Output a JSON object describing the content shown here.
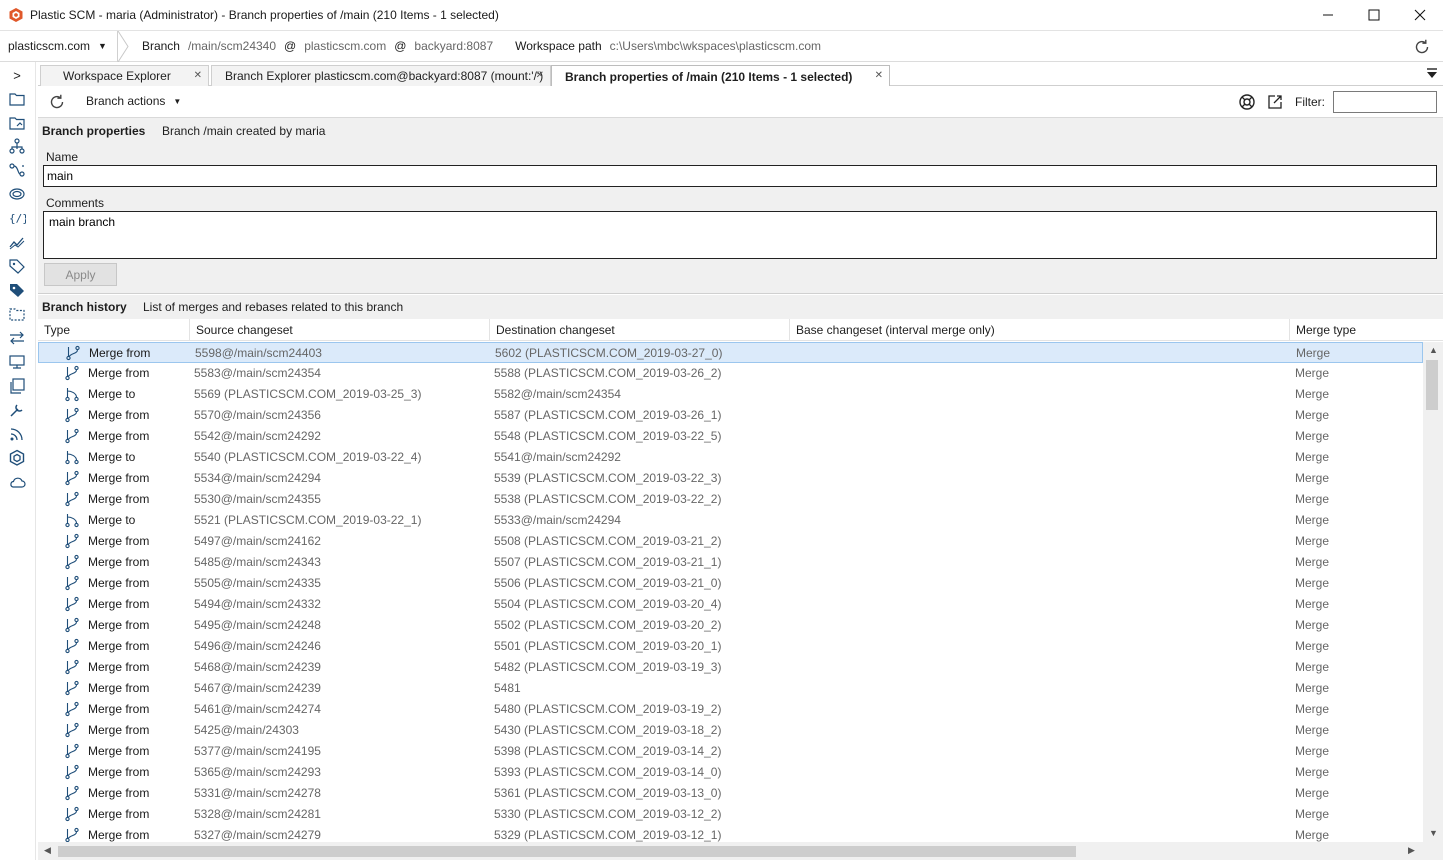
{
  "window": {
    "title": "Plastic SCM - maria (Administrator) - Branch properties of /main (210 Items - 1 selected)"
  },
  "context": {
    "repo": "plasticscm.com",
    "branch_label": "Branch",
    "branch_value": "/main/scm24340",
    "at1": "@",
    "server_repo": "plasticscm.com",
    "at2": "@",
    "server": "backyard:8087",
    "workspace_label": "Workspace path",
    "workspace_value": "c:\\Users\\mbc\\wkspaces\\plasticscm.com"
  },
  "sidebar": {
    "expand": ">"
  },
  "tabs": [
    {
      "label": "Workspace Explorer",
      "close": "✕"
    },
    {
      "label": "Branch Explorer plasticscm.com@backyard:8087 (mount:'/')",
      "close": "✕"
    },
    {
      "label": "Branch properties of /main (210 Items - 1 selected)",
      "close": "✕"
    }
  ],
  "toolbar": {
    "branch_actions": "Branch actions",
    "filter_label": "Filter:",
    "filter_value": ""
  },
  "properties": {
    "title": "Branch properties",
    "desc": "Branch /main created by maria",
    "name_label": "Name",
    "name_value": "main",
    "comments_label": "Comments",
    "comments_value": "main branch",
    "apply": "Apply"
  },
  "history": {
    "title": "Branch history",
    "desc": "List of merges and rebases related to this branch",
    "columns": {
      "type": "Type",
      "source": "Source changeset",
      "destination": "Destination changeset",
      "base": "Base changeset (interval merge only)",
      "merge_type": "Merge type"
    },
    "rows": [
      {
        "type": "Merge from",
        "src": "5598@/main/scm24403",
        "dst": "5602 (PLASTICSCM.COM_2019-03-27_0)",
        "mt": "Merge"
      },
      {
        "type": "Merge from",
        "src": "5583@/main/scm24354",
        "dst": "5588 (PLASTICSCM.COM_2019-03-26_2)",
        "mt": "Merge"
      },
      {
        "type": "Merge to",
        "src": "5569 (PLASTICSCM.COM_2019-03-25_3)",
        "dst": "5582@/main/scm24354",
        "mt": "Merge"
      },
      {
        "type": "Merge from",
        "src": "5570@/main/scm24356",
        "dst": "5587 (PLASTICSCM.COM_2019-03-26_1)",
        "mt": "Merge"
      },
      {
        "type": "Merge from",
        "src": "5542@/main/scm24292",
        "dst": "5548 (PLASTICSCM.COM_2019-03-22_5)",
        "mt": "Merge"
      },
      {
        "type": "Merge to",
        "src": "5540 (PLASTICSCM.COM_2019-03-22_4)",
        "dst": "5541@/main/scm24292",
        "mt": "Merge"
      },
      {
        "type": "Merge from",
        "src": "5534@/main/scm24294",
        "dst": "5539 (PLASTICSCM.COM_2019-03-22_3)",
        "mt": "Merge"
      },
      {
        "type": "Merge from",
        "src": "5530@/main/scm24355",
        "dst": "5538 (PLASTICSCM.COM_2019-03-22_2)",
        "mt": "Merge"
      },
      {
        "type": "Merge to",
        "src": "5521 (PLASTICSCM.COM_2019-03-22_1)",
        "dst": "5533@/main/scm24294",
        "mt": "Merge"
      },
      {
        "type": "Merge from",
        "src": "5497@/main/scm24162",
        "dst": "5508 (PLASTICSCM.COM_2019-03-21_2)",
        "mt": "Merge"
      },
      {
        "type": "Merge from",
        "src": "5485@/main/scm24343",
        "dst": "5507 (PLASTICSCM.COM_2019-03-21_1)",
        "mt": "Merge"
      },
      {
        "type": "Merge from",
        "src": "5505@/main/scm24335",
        "dst": "5506 (PLASTICSCM.COM_2019-03-21_0)",
        "mt": "Merge"
      },
      {
        "type": "Merge from",
        "src": "5494@/main/scm24332",
        "dst": "5504 (PLASTICSCM.COM_2019-03-20_4)",
        "mt": "Merge"
      },
      {
        "type": "Merge from",
        "src": "5495@/main/scm24248",
        "dst": "5502 (PLASTICSCM.COM_2019-03-20_2)",
        "mt": "Merge"
      },
      {
        "type": "Merge from",
        "src": "5496@/main/scm24246",
        "dst": "5501 (PLASTICSCM.COM_2019-03-20_1)",
        "mt": "Merge"
      },
      {
        "type": "Merge from",
        "src": "5468@/main/scm24239",
        "dst": "5482 (PLASTICSCM.COM_2019-03-19_3)",
        "mt": "Merge"
      },
      {
        "type": "Merge from",
        "src": "5467@/main/scm24239",
        "dst": "5481",
        "mt": "Merge"
      },
      {
        "type": "Merge from",
        "src": "5461@/main/scm24274",
        "dst": "5480 (PLASTICSCM.COM_2019-03-19_2)",
        "mt": "Merge"
      },
      {
        "type": "Merge from",
        "src": "5425@/main/24303",
        "dst": "5430 (PLASTICSCM.COM_2019-03-18_2)",
        "mt": "Merge"
      },
      {
        "type": "Merge from",
        "src": "5377@/main/scm24195",
        "dst": "5398 (PLASTICSCM.COM_2019-03-14_2)",
        "mt": "Merge"
      },
      {
        "type": "Merge from",
        "src": "5365@/main/scm24293",
        "dst": "5393 (PLASTICSCM.COM_2019-03-14_0)",
        "mt": "Merge"
      },
      {
        "type": "Merge from",
        "src": "5331@/main/scm24278",
        "dst": "5361 (PLASTICSCM.COM_2019-03-13_0)",
        "mt": "Merge"
      },
      {
        "type": "Merge from",
        "src": "5328@/main/scm24281",
        "dst": "5330 (PLASTICSCM.COM_2019-03-12_2)",
        "mt": "Merge"
      },
      {
        "type": "Merge from",
        "src": "5327@/main/scm24279",
        "dst": "5329 (PLASTICSCM.COM_2019-03-12_1)",
        "mt": "Merge"
      }
    ]
  },
  "colors": {
    "brand": "#e0582a",
    "icon": "#1f4e79",
    "selection": "#dbeafa"
  },
  "icons": {
    "merge_from": "merge-from-icon",
    "merge_to": "merge-to-icon"
  }
}
